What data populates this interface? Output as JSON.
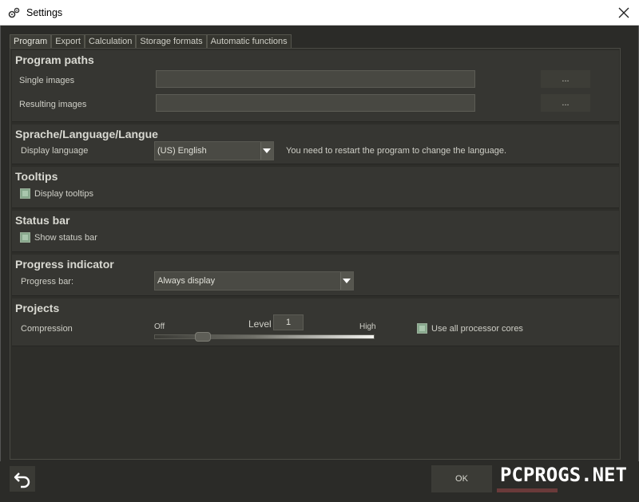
{
  "window": {
    "title": "Settings",
    "app_icon": "gears-icon",
    "close_icon": "close-icon"
  },
  "tabs": [
    {
      "label": "Program",
      "active": true
    },
    {
      "label": "Export"
    },
    {
      "label": "Calculation"
    },
    {
      "label": "Storage formats"
    },
    {
      "label": "Automatic functions"
    }
  ],
  "program_paths": {
    "title": "Program paths",
    "single_images_label": "Single images",
    "single_images_value": "",
    "resulting_images_label": "Resulting images",
    "resulting_images_value": "",
    "browse_label": "..."
  },
  "language": {
    "title": "Sprache/Language/Langue",
    "display_language_label": "Display language",
    "selected": "(US) English",
    "hint": "You need to restart the program to change the language."
  },
  "tooltips": {
    "title": "Tooltips",
    "checkbox_label": "Display tooltips",
    "checked": true
  },
  "status_bar": {
    "title": "Status bar",
    "checkbox_label": "Show status bar",
    "checked": true
  },
  "progress": {
    "title": "Progress indicator",
    "label": "Progress bar:",
    "selected": "Always display"
  },
  "projects": {
    "title": "Projects",
    "compression_label": "Compression",
    "off_label": "Off",
    "high_label": "High",
    "level_label": "Level",
    "level_value": "1",
    "slider_fraction": 0.22,
    "cores_label": "Use all processor cores",
    "cores_checked": true
  },
  "footer": {
    "ok_label": "OK",
    "undo_icon": "undo-icon"
  },
  "watermark": "PCPROGS.NET",
  "colors": {
    "accent_check": "#87a78c",
    "background": "#2b2b28",
    "panel": "#363632"
  }
}
